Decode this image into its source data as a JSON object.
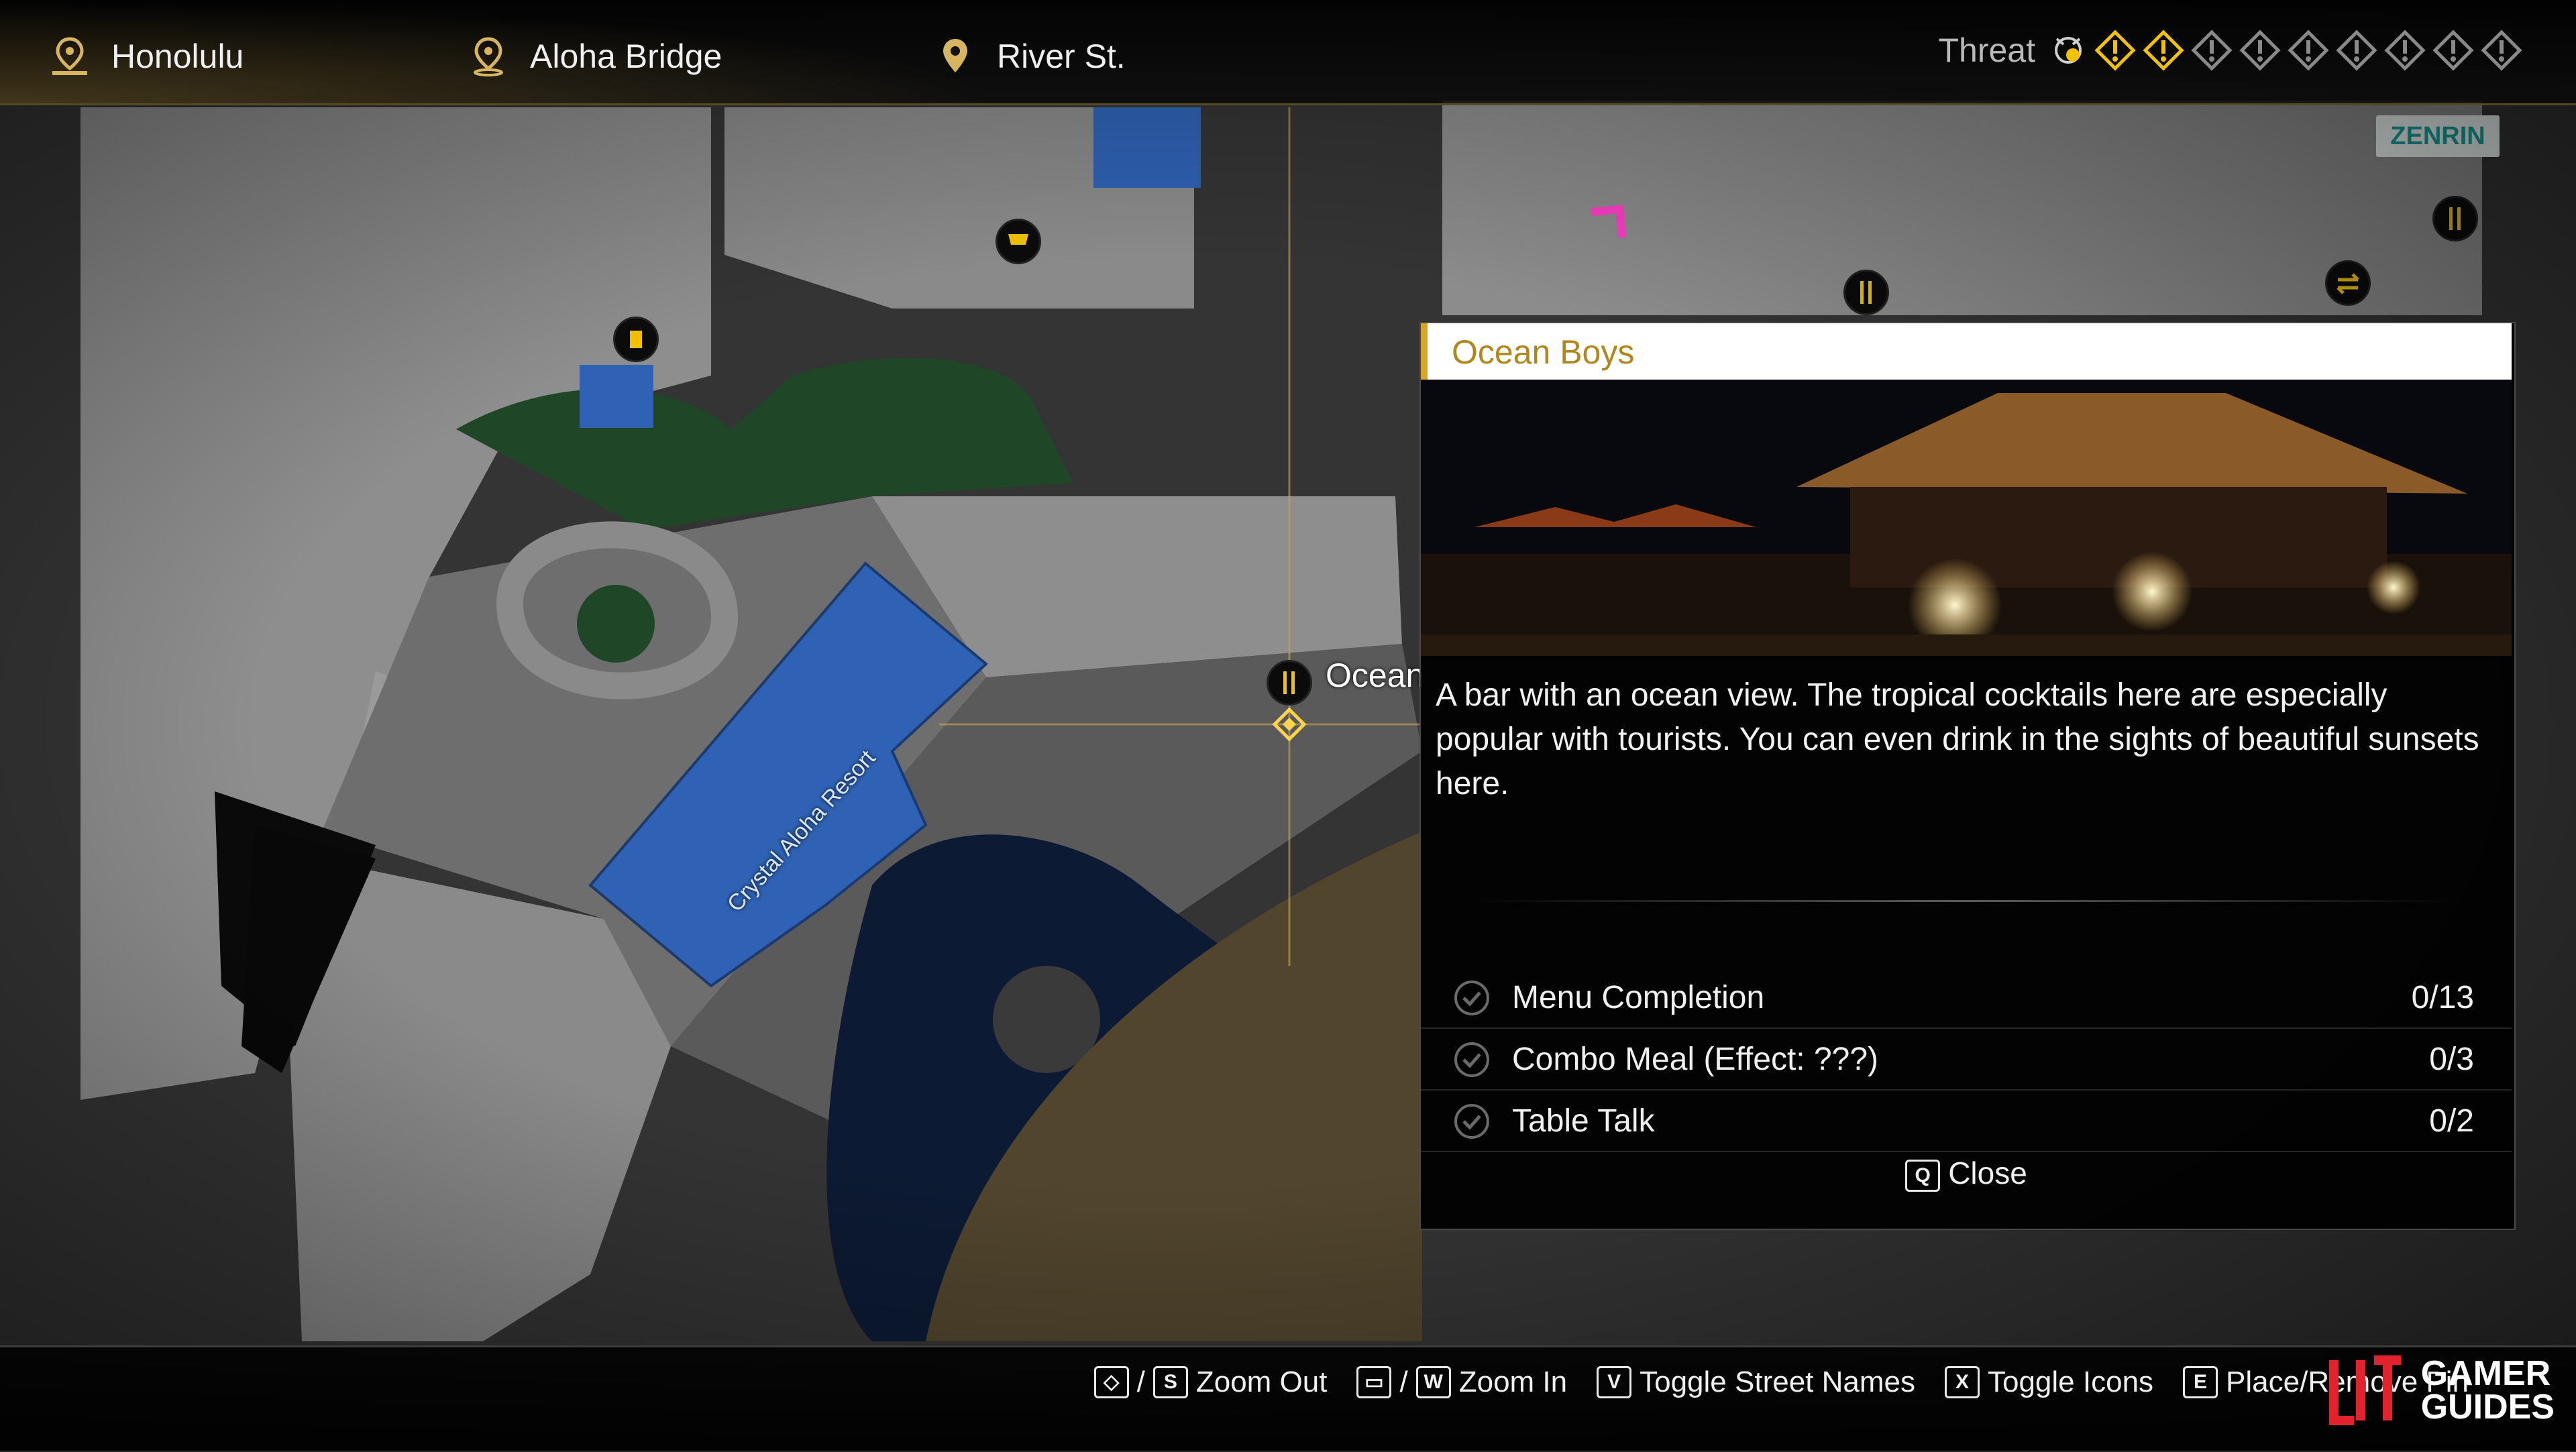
{
  "topbar": {
    "locations": [
      {
        "label": "Honolulu",
        "icon": "district-pin-icon"
      },
      {
        "label": "Aloha Bridge",
        "icon": "area-pin-icon"
      },
      {
        "label": "River St.",
        "icon": "street-pin-icon"
      }
    ],
    "threat": {
      "label": "Threat",
      "level": 2,
      "max": 9,
      "active_color": "#f2c200",
      "inactive_color": "#8a8a8a"
    }
  },
  "map": {
    "zenrin_logo": "ZENRIN",
    "building_label": "Crystal Aloha Resort",
    "selected_marker_label": "Ocean",
    "icons": [
      "drink-icon",
      "shop-cart-icon",
      "restaurant-icon",
      "restaurant-icon",
      "exchange-icon",
      "restaurant-icon",
      "pink-arrow-marker-icon",
      "bar-icon"
    ],
    "water_color": "#0c1a33",
    "building_color": "#2f62b4",
    "grass_color": "#1e4025",
    "road_color": "#9a9a9a"
  },
  "panel": {
    "title": "Ocean Boys",
    "description": "A bar with an ocean view. The tropical cocktails here are especially popular with tourists. You can even drink in the sights of beautiful sunsets here.",
    "rows": [
      {
        "name": "Menu Completion",
        "value": "0/13"
      },
      {
        "name": "Combo Meal (Effect: ???)",
        "value": "0/3"
      },
      {
        "name": "Table Talk",
        "value": "0/2"
      }
    ],
    "close": {
      "key": "Q",
      "label": "Close"
    },
    "accent": "#d8a623"
  },
  "controls": [
    {
      "keys": [
        "◇",
        "S"
      ],
      "label": "Zoom Out"
    },
    {
      "keys": [
        "▭",
        "W"
      ],
      "label": "Zoom In"
    },
    {
      "keys": [
        "V"
      ],
      "label": "Toggle Street Names"
    },
    {
      "keys": [
        "X"
      ],
      "label": "Toggle Icons"
    },
    {
      "keys": [
        "E"
      ],
      "label": "Place/Remove Pin"
    }
  ],
  "watermark": {
    "line1": "GAMER",
    "line2": "GUIDES"
  }
}
